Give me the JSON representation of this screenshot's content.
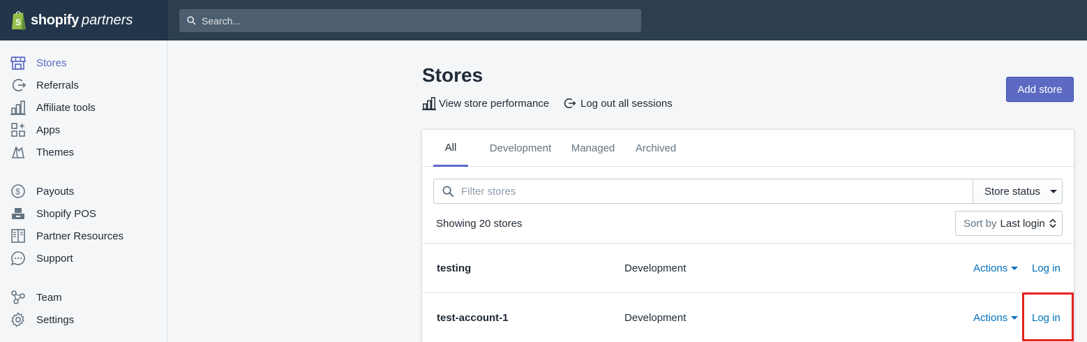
{
  "brand": {
    "name": "shopify",
    "sub": "partners"
  },
  "search": {
    "placeholder": "Search..."
  },
  "sidebar": {
    "items": [
      {
        "label": "Stores",
        "icon": "store-icon",
        "active": true
      },
      {
        "label": "Referrals",
        "icon": "referral-icon"
      },
      {
        "label": "Affiliate tools",
        "icon": "analytics-icon"
      },
      {
        "label": "Apps",
        "icon": "apps-icon"
      },
      {
        "label": "Themes",
        "icon": "themes-icon"
      },
      {
        "label": "Payouts",
        "icon": "dollar-icon"
      },
      {
        "label": "Shopify POS",
        "icon": "pos-icon"
      },
      {
        "label": "Partner Resources",
        "icon": "book-icon"
      },
      {
        "label": "Support",
        "icon": "chat-icon"
      },
      {
        "label": "Team",
        "icon": "team-icon"
      },
      {
        "label": "Settings",
        "icon": "gear-icon"
      }
    ]
  },
  "page": {
    "title": "Stores",
    "view_performance": "View store performance",
    "logout_sessions": "Log out all sessions",
    "add_store": "Add store"
  },
  "tabs": [
    {
      "label": "All",
      "active": true
    },
    {
      "label": "Development"
    },
    {
      "label": "Managed"
    },
    {
      "label": "Archived"
    }
  ],
  "filters": {
    "placeholder": "Filter stores",
    "status_label": "Store status",
    "sort_prefix": "Sort by",
    "sort_value": "Last login",
    "showing": "Showing 20 stores"
  },
  "stores": [
    {
      "name": "testing",
      "type": "Development",
      "actions": "Actions",
      "login": "Log in"
    },
    {
      "name": "test-account-1",
      "type": "Development",
      "actions": "Actions",
      "login": "Log in"
    }
  ],
  "colors": {
    "topbar": "#2c3e50",
    "accent": "#5c6ac4",
    "link": "#006fbb",
    "highlight": "#e5231f"
  }
}
